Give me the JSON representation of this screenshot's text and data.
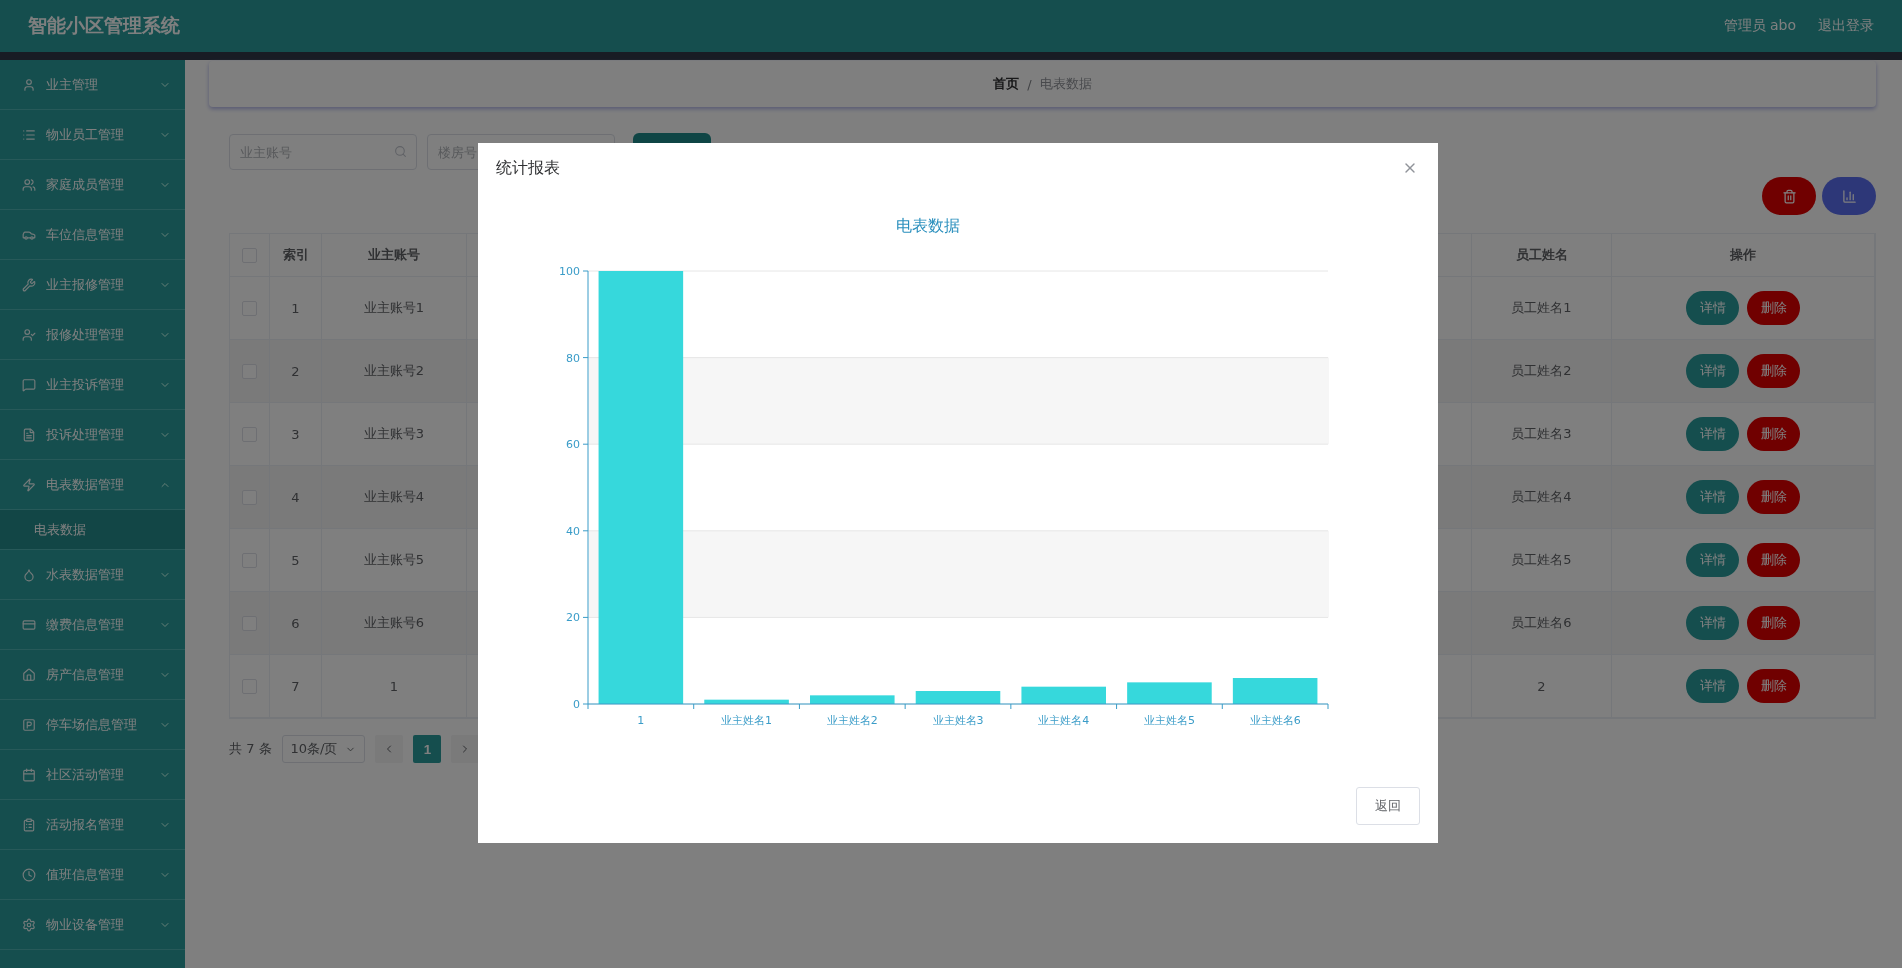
{
  "header": {
    "title": "智能小区管理系统",
    "user": "管理员 abo",
    "logout": "退出登录"
  },
  "sidebar": {
    "items": [
      {
        "label": "业主管理",
        "expanded": false
      },
      {
        "label": "物业员工管理",
        "expanded": false
      },
      {
        "label": "家庭成员管理",
        "expanded": false
      },
      {
        "label": "车位信息管理",
        "expanded": false
      },
      {
        "label": "业主报修管理",
        "expanded": false
      },
      {
        "label": "报修处理管理",
        "expanded": false
      },
      {
        "label": "业主投诉管理",
        "expanded": false
      },
      {
        "label": "投诉处理管理",
        "expanded": false
      },
      {
        "label": "电表数据管理",
        "expanded": true,
        "children": [
          {
            "label": "电表数据"
          }
        ]
      },
      {
        "label": "水表数据管理",
        "expanded": false
      },
      {
        "label": "缴费信息管理",
        "expanded": false
      },
      {
        "label": "房产信息管理",
        "expanded": false
      },
      {
        "label": "停车场信息管理",
        "expanded": false
      },
      {
        "label": "社区活动管理",
        "expanded": false
      },
      {
        "label": "活动报名管理",
        "expanded": false
      },
      {
        "label": "值班信息管理",
        "expanded": false
      },
      {
        "label": "物业设备管理",
        "expanded": false
      }
    ]
  },
  "breadcrumb": {
    "items": [
      "首页",
      "电表数据"
    ],
    "separator": "/"
  },
  "search": {
    "fields": [
      {
        "placeholder": "业主账号"
      },
      {
        "placeholder": "楼房号"
      }
    ]
  },
  "table": {
    "header_checked": false,
    "columns": [
      "索引",
      "业主账号",
      "员工姓名",
      "操作"
    ],
    "rows": [
      {
        "checked": false,
        "cells": [
          "1",
          "业主账号1",
          "员工姓名1"
        ],
        "actions": [
          "详情",
          "删除"
        ]
      },
      {
        "checked": false,
        "cells": [
          "2",
          "业主账号2",
          "员工姓名2"
        ],
        "actions": [
          "详情",
          "删除"
        ]
      },
      {
        "checked": false,
        "cells": [
          "3",
          "业主账号3",
          "员工姓名3"
        ],
        "actions": [
          "详情",
          "删除"
        ]
      },
      {
        "checked": false,
        "cells": [
          "4",
          "业主账号4",
          "员工姓名4"
        ],
        "actions": [
          "详情",
          "删除"
        ]
      },
      {
        "checked": false,
        "cells": [
          "5",
          "业主账号5",
          "员工姓名5"
        ],
        "actions": [
          "详情",
          "删除"
        ]
      },
      {
        "checked": false,
        "cells": [
          "6",
          "业主账号6",
          "员工姓名6"
        ],
        "actions": [
          "详情",
          "删除"
        ]
      },
      {
        "checked": false,
        "cells": [
          "7",
          "1",
          "2"
        ],
        "actions": [
          "详情",
          "删除"
        ]
      }
    ]
  },
  "pagination": {
    "total": "共 7 条",
    "page_size": "10条/页",
    "pages": [
      {
        "label": "1",
        "selected": true
      }
    ]
  },
  "dialog": {
    "title": "统计报表",
    "buttons": [
      "返回"
    ],
    "chart_data": {
      "type": "bar",
      "title": "电表数据",
      "categories": [
        "1",
        "业主姓名1",
        "业主姓名2",
        "业主姓名3",
        "业主姓名4",
        "业主姓名5",
        "业主姓名6"
      ],
      "values": [
        100,
        1,
        2,
        3,
        4,
        5,
        6
      ],
      "grid": true,
      "ylim": [
        0,
        100
      ],
      "yticks": [
        0,
        20,
        40,
        60,
        80,
        100
      ]
    }
  }
}
